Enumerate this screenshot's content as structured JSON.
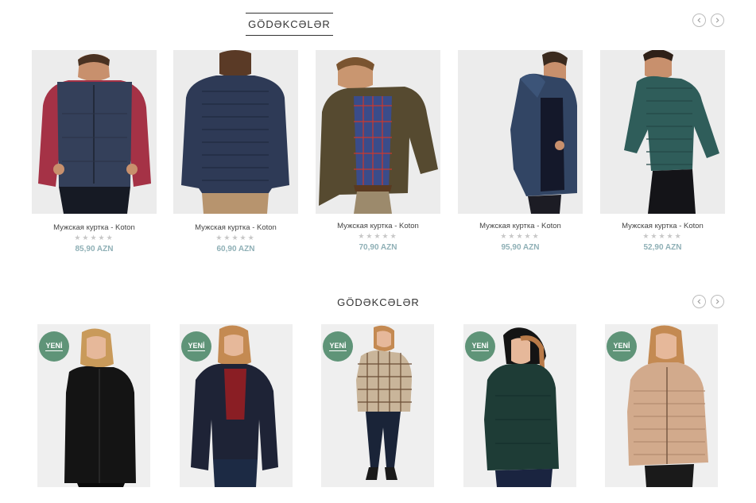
{
  "section1": {
    "title": "GÖDƏKCƏLƏR",
    "products": [
      {
        "name": "Мужская куртка - Koton",
        "price": "85,90 AZN",
        "stars": "★★★★★"
      },
      {
        "name": "Мужская куртка - Koton",
        "price": "60,90 AZN",
        "stars": "★★★★★"
      },
      {
        "name": "Мужская куртка - Koton",
        "price": "70,90 AZN",
        "stars": "★★★★★"
      },
      {
        "name": "Мужская куртка - Koton",
        "price": "95,90 AZN",
        "stars": "★★★★★"
      },
      {
        "name": "Мужская куртка - Koton",
        "price": "52,90 AZN",
        "stars": "★★★★★"
      }
    ]
  },
  "section2": {
    "title": "GÖDƏKCƏLƏR",
    "badge": "YENİ",
    "products": [
      {
        "badge": "YENİ"
      },
      {
        "badge": "YENİ"
      },
      {
        "badge": "YENİ"
      },
      {
        "badge": "YENİ"
      },
      {
        "badge": "YENİ"
      }
    ]
  },
  "icons": {
    "prev": "chevron-left-icon",
    "next": "chevron-right-icon"
  },
  "colors": {
    "badge": "#5f9478",
    "price": "#8fb0b6",
    "rating": "#c8c8c8"
  }
}
